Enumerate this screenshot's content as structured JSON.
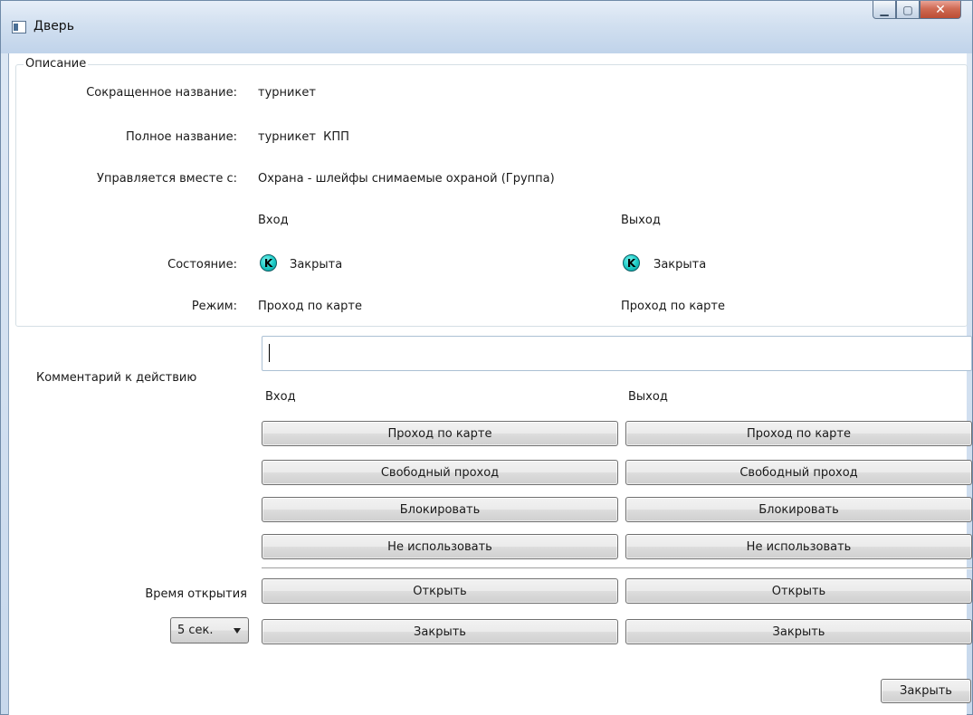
{
  "window": {
    "title": "Дверь"
  },
  "description": {
    "legend": "Описание",
    "short_name_label": "Сокращенное название:",
    "short_name_value": "турникет",
    "full_name_label": "Полное название:",
    "full_name_value": "турникет  КПП",
    "controlled_with_label": "Управляется вместе с:",
    "controlled_with_value": "Охрана - шлейфы снимаемые охраной (Группа)",
    "entry_header": "Вход",
    "exit_header": "Выход",
    "state_label": "Состояние:",
    "entry_state": "Закрыта",
    "exit_state": "Закрыта",
    "state_icon_letter": "K",
    "mode_label": "Режим:",
    "entry_mode": "Проход по карте",
    "exit_mode": "Проход по карте"
  },
  "comment": {
    "label": "Комментарий к действию",
    "value": ""
  },
  "actions": {
    "entry_header": "Вход",
    "exit_header": "Выход",
    "entry_buttons": [
      "Проход по карте",
      "Свободный проход",
      "Блокировать",
      "Не использовать"
    ],
    "exit_buttons": [
      "Проход по карте",
      "Свободный проход",
      "Блокировать",
      "Не использовать"
    ],
    "open_time_label": "Время открытия",
    "open_time_value": "5 сек.",
    "open_label": "Открыть",
    "close_label": "Закрыть"
  },
  "footer": {
    "close_label": "Закрыть"
  },
  "colors": {
    "accent": "#19c9c4",
    "window_frame": "#c7d8ec"
  }
}
